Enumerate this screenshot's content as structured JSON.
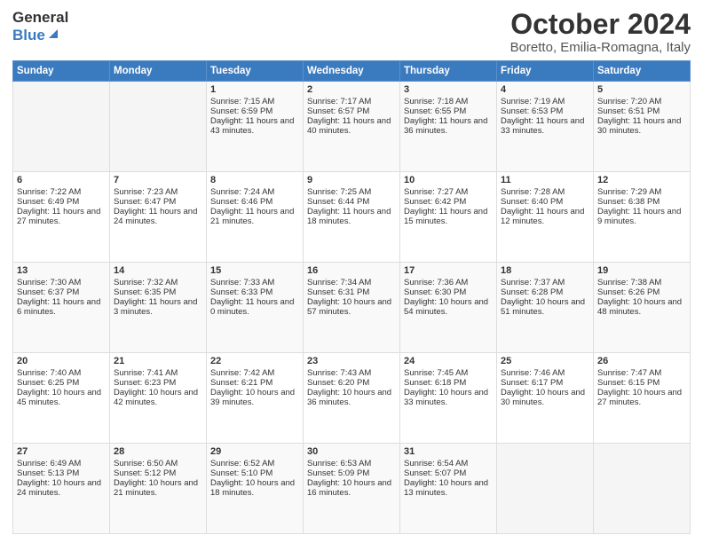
{
  "header": {
    "logo_line1": "General",
    "logo_line2": "Blue",
    "title": "October 2024",
    "subtitle": "Boretto, Emilia-Romagna, Italy"
  },
  "days_of_week": [
    "Sunday",
    "Monday",
    "Tuesday",
    "Wednesday",
    "Thursday",
    "Friday",
    "Saturday"
  ],
  "weeks": [
    [
      {
        "day": "",
        "sunrise": "",
        "sunset": "",
        "daylight": ""
      },
      {
        "day": "",
        "sunrise": "",
        "sunset": "",
        "daylight": ""
      },
      {
        "day": "1",
        "sunrise": "Sunrise: 7:15 AM",
        "sunset": "Sunset: 6:59 PM",
        "daylight": "Daylight: 11 hours and 43 minutes."
      },
      {
        "day": "2",
        "sunrise": "Sunrise: 7:17 AM",
        "sunset": "Sunset: 6:57 PM",
        "daylight": "Daylight: 11 hours and 40 minutes."
      },
      {
        "day": "3",
        "sunrise": "Sunrise: 7:18 AM",
        "sunset": "Sunset: 6:55 PM",
        "daylight": "Daylight: 11 hours and 36 minutes."
      },
      {
        "day": "4",
        "sunrise": "Sunrise: 7:19 AM",
        "sunset": "Sunset: 6:53 PM",
        "daylight": "Daylight: 11 hours and 33 minutes."
      },
      {
        "day": "5",
        "sunrise": "Sunrise: 7:20 AM",
        "sunset": "Sunset: 6:51 PM",
        "daylight": "Daylight: 11 hours and 30 minutes."
      }
    ],
    [
      {
        "day": "6",
        "sunrise": "Sunrise: 7:22 AM",
        "sunset": "Sunset: 6:49 PM",
        "daylight": "Daylight: 11 hours and 27 minutes."
      },
      {
        "day": "7",
        "sunrise": "Sunrise: 7:23 AM",
        "sunset": "Sunset: 6:47 PM",
        "daylight": "Daylight: 11 hours and 24 minutes."
      },
      {
        "day": "8",
        "sunrise": "Sunrise: 7:24 AM",
        "sunset": "Sunset: 6:46 PM",
        "daylight": "Daylight: 11 hours and 21 minutes."
      },
      {
        "day": "9",
        "sunrise": "Sunrise: 7:25 AM",
        "sunset": "Sunset: 6:44 PM",
        "daylight": "Daylight: 11 hours and 18 minutes."
      },
      {
        "day": "10",
        "sunrise": "Sunrise: 7:27 AM",
        "sunset": "Sunset: 6:42 PM",
        "daylight": "Daylight: 11 hours and 15 minutes."
      },
      {
        "day": "11",
        "sunrise": "Sunrise: 7:28 AM",
        "sunset": "Sunset: 6:40 PM",
        "daylight": "Daylight: 11 hours and 12 minutes."
      },
      {
        "day": "12",
        "sunrise": "Sunrise: 7:29 AM",
        "sunset": "Sunset: 6:38 PM",
        "daylight": "Daylight: 11 hours and 9 minutes."
      }
    ],
    [
      {
        "day": "13",
        "sunrise": "Sunrise: 7:30 AM",
        "sunset": "Sunset: 6:37 PM",
        "daylight": "Daylight: 11 hours and 6 minutes."
      },
      {
        "day": "14",
        "sunrise": "Sunrise: 7:32 AM",
        "sunset": "Sunset: 6:35 PM",
        "daylight": "Daylight: 11 hours and 3 minutes."
      },
      {
        "day": "15",
        "sunrise": "Sunrise: 7:33 AM",
        "sunset": "Sunset: 6:33 PM",
        "daylight": "Daylight: 11 hours and 0 minutes."
      },
      {
        "day": "16",
        "sunrise": "Sunrise: 7:34 AM",
        "sunset": "Sunset: 6:31 PM",
        "daylight": "Daylight: 10 hours and 57 minutes."
      },
      {
        "day": "17",
        "sunrise": "Sunrise: 7:36 AM",
        "sunset": "Sunset: 6:30 PM",
        "daylight": "Daylight: 10 hours and 54 minutes."
      },
      {
        "day": "18",
        "sunrise": "Sunrise: 7:37 AM",
        "sunset": "Sunset: 6:28 PM",
        "daylight": "Daylight: 10 hours and 51 minutes."
      },
      {
        "day": "19",
        "sunrise": "Sunrise: 7:38 AM",
        "sunset": "Sunset: 6:26 PM",
        "daylight": "Daylight: 10 hours and 48 minutes."
      }
    ],
    [
      {
        "day": "20",
        "sunrise": "Sunrise: 7:40 AM",
        "sunset": "Sunset: 6:25 PM",
        "daylight": "Daylight: 10 hours and 45 minutes."
      },
      {
        "day": "21",
        "sunrise": "Sunrise: 7:41 AM",
        "sunset": "Sunset: 6:23 PM",
        "daylight": "Daylight: 10 hours and 42 minutes."
      },
      {
        "day": "22",
        "sunrise": "Sunrise: 7:42 AM",
        "sunset": "Sunset: 6:21 PM",
        "daylight": "Daylight: 10 hours and 39 minutes."
      },
      {
        "day": "23",
        "sunrise": "Sunrise: 7:43 AM",
        "sunset": "Sunset: 6:20 PM",
        "daylight": "Daylight: 10 hours and 36 minutes."
      },
      {
        "day": "24",
        "sunrise": "Sunrise: 7:45 AM",
        "sunset": "Sunset: 6:18 PM",
        "daylight": "Daylight: 10 hours and 33 minutes."
      },
      {
        "day": "25",
        "sunrise": "Sunrise: 7:46 AM",
        "sunset": "Sunset: 6:17 PM",
        "daylight": "Daylight: 10 hours and 30 minutes."
      },
      {
        "day": "26",
        "sunrise": "Sunrise: 7:47 AM",
        "sunset": "Sunset: 6:15 PM",
        "daylight": "Daylight: 10 hours and 27 minutes."
      }
    ],
    [
      {
        "day": "27",
        "sunrise": "Sunrise: 6:49 AM",
        "sunset": "Sunset: 5:13 PM",
        "daylight": "Daylight: 10 hours and 24 minutes."
      },
      {
        "day": "28",
        "sunrise": "Sunrise: 6:50 AM",
        "sunset": "Sunset: 5:12 PM",
        "daylight": "Daylight: 10 hours and 21 minutes."
      },
      {
        "day": "29",
        "sunrise": "Sunrise: 6:52 AM",
        "sunset": "Sunset: 5:10 PM",
        "daylight": "Daylight: 10 hours and 18 minutes."
      },
      {
        "day": "30",
        "sunrise": "Sunrise: 6:53 AM",
        "sunset": "Sunset: 5:09 PM",
        "daylight": "Daylight: 10 hours and 16 minutes."
      },
      {
        "day": "31",
        "sunrise": "Sunrise: 6:54 AM",
        "sunset": "Sunset: 5:07 PM",
        "daylight": "Daylight: 10 hours and 13 minutes."
      },
      {
        "day": "",
        "sunrise": "",
        "sunset": "",
        "daylight": ""
      },
      {
        "day": "",
        "sunrise": "",
        "sunset": "",
        "daylight": ""
      }
    ]
  ]
}
